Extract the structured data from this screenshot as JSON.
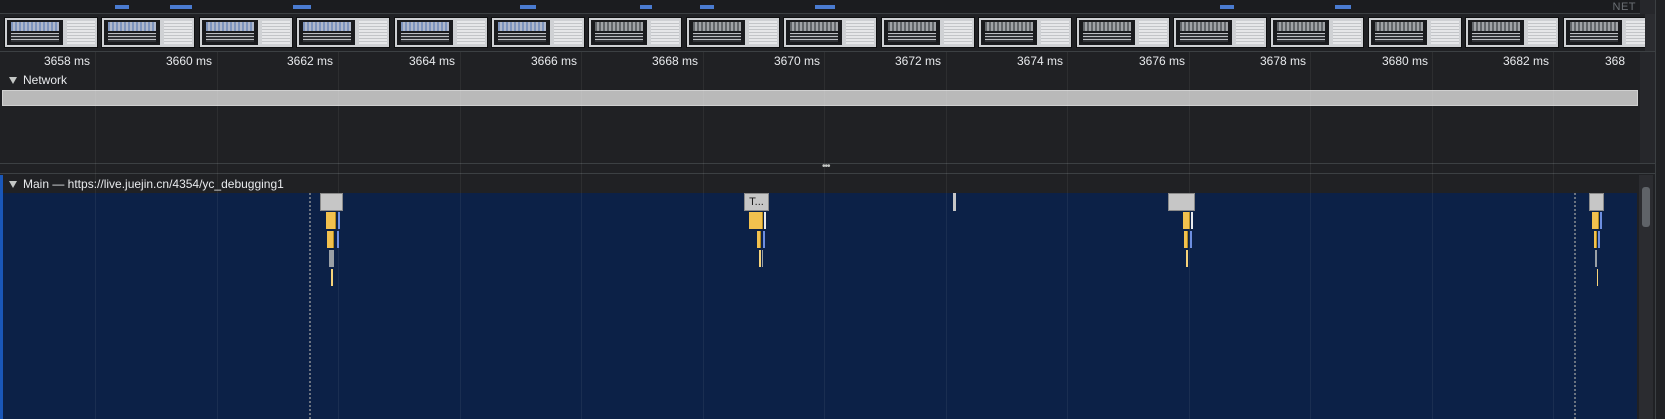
{
  "overview": {
    "corner_label": "NET"
  },
  "ruler": {
    "ticks": [
      "3658 ms",
      "3660 ms",
      "3662 ms",
      "3664 ms",
      "3666 ms",
      "3668 ms",
      "3670 ms",
      "3672 ms",
      "3674 ms",
      "3676 ms",
      "3678 ms",
      "3680 ms",
      "3682 ms",
      "368"
    ]
  },
  "network": {
    "title": "Network"
  },
  "main": {
    "title": "Main — https://live.juejin.cn/4354/yc_debugging1",
    "task_labels": {
      "second": "T..."
    }
  },
  "colors": {
    "main_background": "#0c2147",
    "task_gray": "#c6c6c6",
    "scripting_yellow": "#f2c14e",
    "accent_blue": "#1a57b8"
  }
}
